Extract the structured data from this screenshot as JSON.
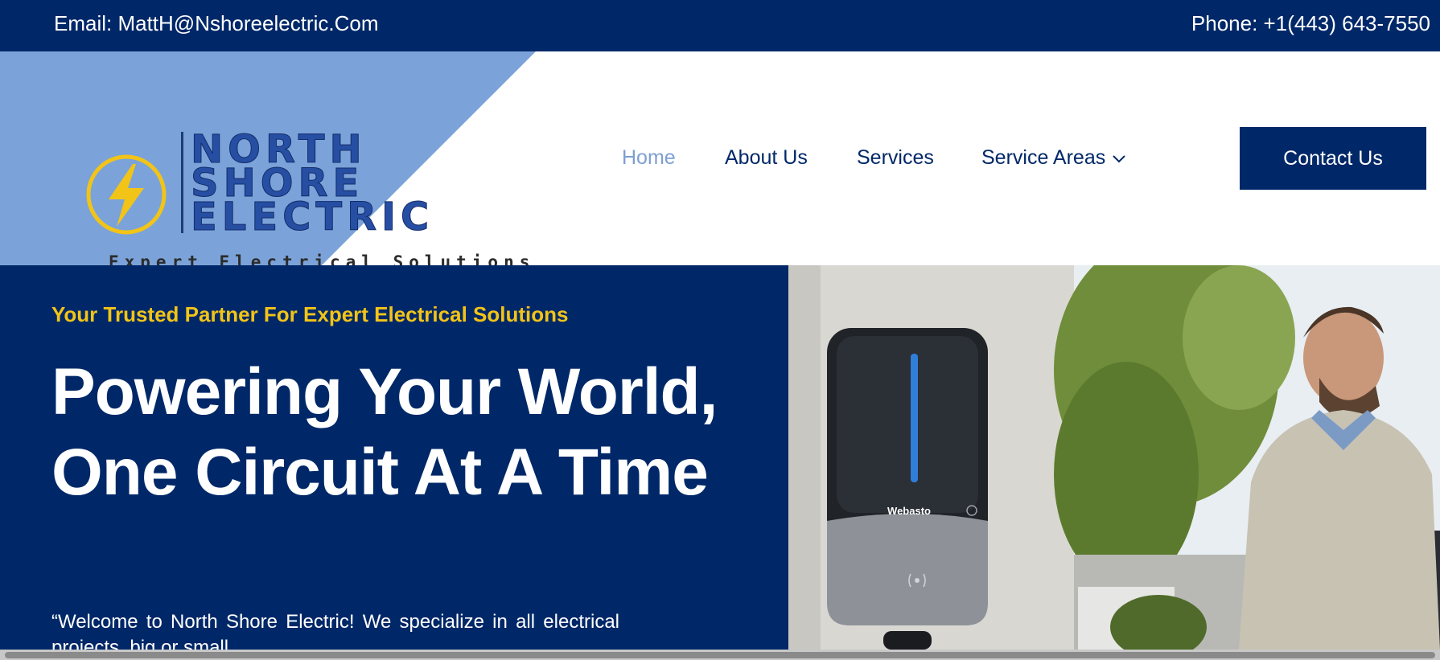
{
  "topbar": {
    "email": "Email: MattH@Nshoreelectric.Com",
    "phone": "Phone: +1(443) 643-7550"
  },
  "logo": {
    "line1": "NORTH",
    "line2": "SHORE",
    "line3": "ELECTRIC",
    "tagline": "Expert Electrical Solutions"
  },
  "nav": {
    "items": [
      {
        "label": "Home",
        "active": true
      },
      {
        "label": "About Us"
      },
      {
        "label": "Services"
      },
      {
        "label": "Service Areas",
        "icon": "chevron-down-icon"
      }
    ],
    "cta": "Contact Us"
  },
  "hero": {
    "kicker": "Your Trusted Partner For Expert Electrical Solutions",
    "title": "Powering Your World, One Circuit At A Time",
    "text": "“Welcome to North Shore Electric! We specialize in all electrical projects, big or small",
    "image": {
      "charger_brand": "Webasto"
    }
  },
  "colors": {
    "navy": "#002868",
    "logo_bg": "#7ba3d9",
    "accent_yellow": "#f2c417",
    "active_nav": "#7d9fd2"
  }
}
